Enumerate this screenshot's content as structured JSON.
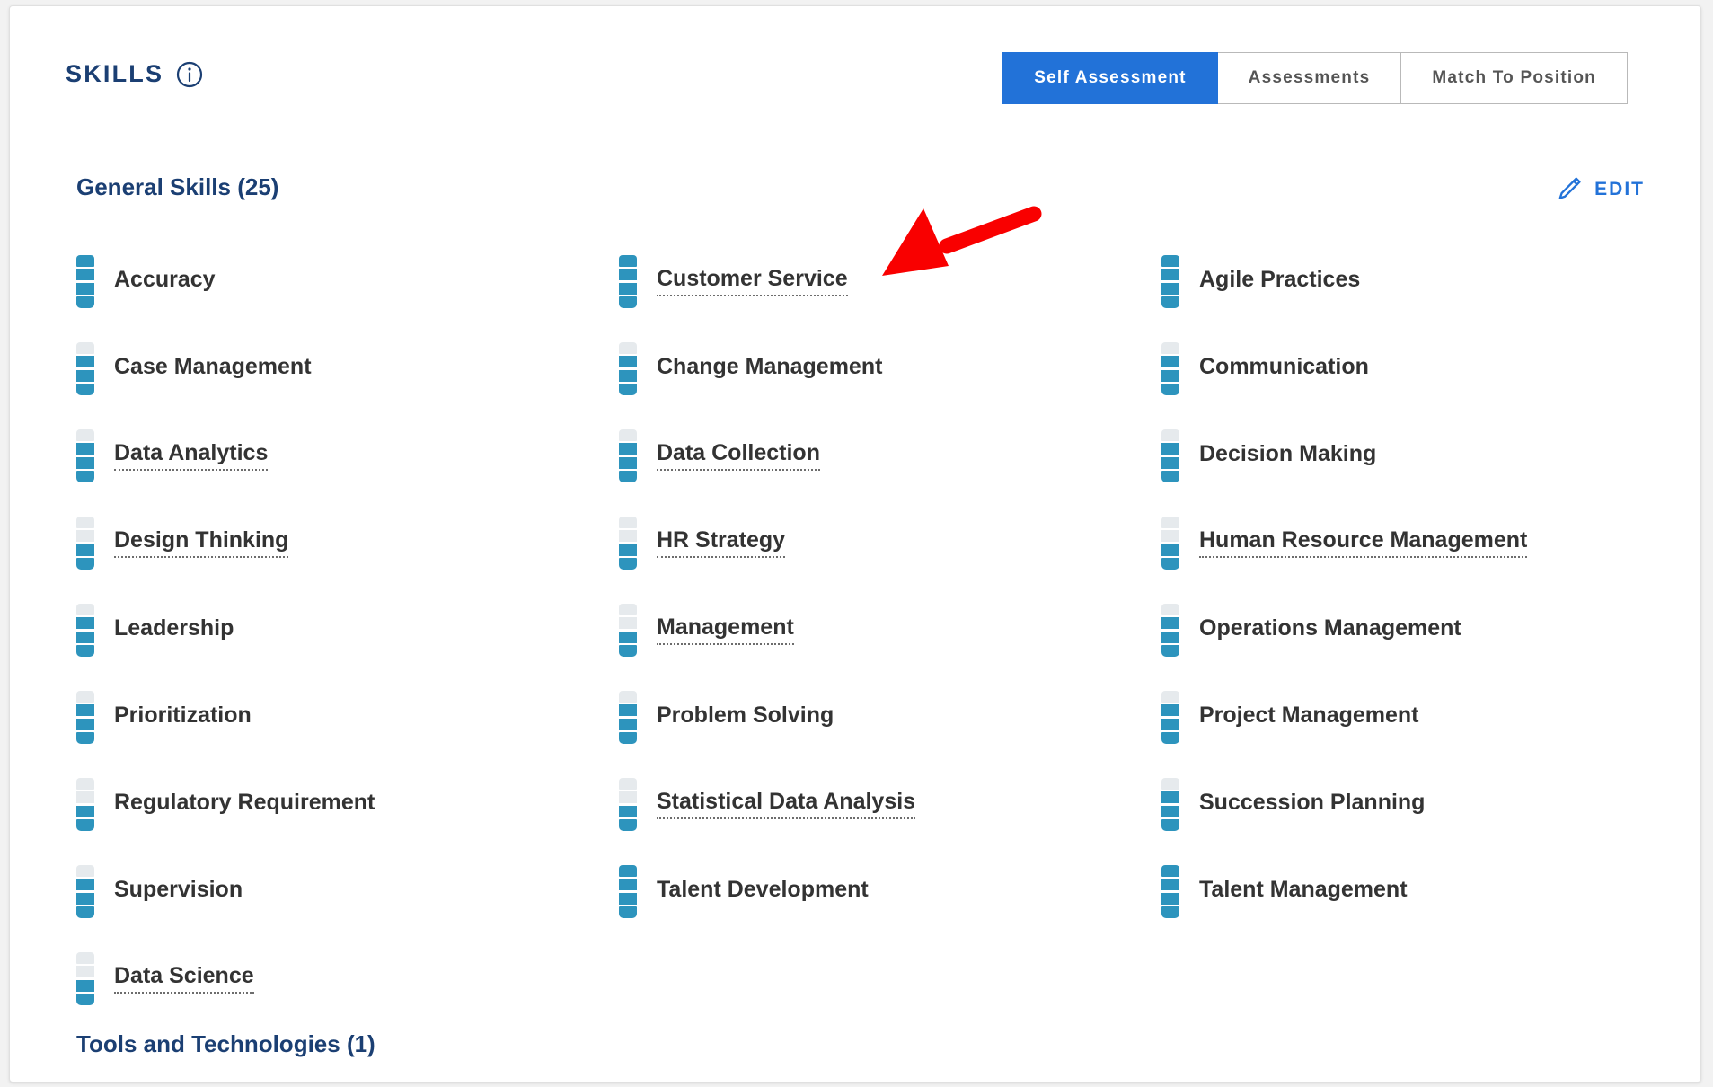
{
  "header": {
    "title": "SKILLS",
    "info_icon": "info-circle-icon",
    "tabs": [
      {
        "label": "Self Assessment",
        "active": true
      },
      {
        "label": "Assessments",
        "active": false
      },
      {
        "label": "Match To Position",
        "active": false
      }
    ]
  },
  "general_skills": {
    "heading": "General Skills (25)",
    "edit_label": "EDIT",
    "edit_icon": "pencil-icon",
    "max_level": 4,
    "columns": [
      [
        {
          "label": "Accuracy",
          "level": 4,
          "dotted": false
        },
        {
          "label": "Case Management",
          "level": 3,
          "dotted": false
        },
        {
          "label": "Data Analytics",
          "level": 3,
          "dotted": true
        },
        {
          "label": "Design Thinking",
          "level": 2,
          "dotted": true
        },
        {
          "label": "Leadership",
          "level": 3,
          "dotted": false
        },
        {
          "label": "Prioritization",
          "level": 3,
          "dotted": false
        },
        {
          "label": "Regulatory Requirement",
          "level": 2,
          "dotted": false
        },
        {
          "label": "Supervision",
          "level": 3,
          "dotted": false
        },
        {
          "label": "Data Science",
          "level": 2,
          "dotted": true
        }
      ],
      [
        {
          "label": "Customer Service",
          "level": 4,
          "dotted": true
        },
        {
          "label": "Change Management",
          "level": 3,
          "dotted": false
        },
        {
          "label": "Data Collection",
          "level": 3,
          "dotted": true
        },
        {
          "label": "HR Strategy",
          "level": 2,
          "dotted": true
        },
        {
          "label": "Management",
          "level": 2,
          "dotted": true
        },
        {
          "label": "Problem Solving",
          "level": 3,
          "dotted": false
        },
        {
          "label": "Statistical Data Analysis",
          "level": 2,
          "dotted": true
        },
        {
          "label": "Talent Development",
          "level": 4,
          "dotted": false
        }
      ],
      [
        {
          "label": "Agile Practices",
          "level": 4,
          "dotted": false
        },
        {
          "label": "Communication",
          "level": 3,
          "dotted": false
        },
        {
          "label": "Decision Making",
          "level": 3,
          "dotted": false
        },
        {
          "label": "Human Resource Management",
          "level": 2,
          "dotted": true
        },
        {
          "label": "Operations Management",
          "level": 3,
          "dotted": false
        },
        {
          "label": "Project Management",
          "level": 3,
          "dotted": false
        },
        {
          "label": "Succession Planning",
          "level": 3,
          "dotted": false
        },
        {
          "label": "Talent Management",
          "level": 4,
          "dotted": false
        }
      ]
    ]
  },
  "tools_and_technologies": {
    "heading": "Tools and Technologies (1)"
  },
  "annotation": {
    "arrow_icon": "red-arrow-pointer",
    "points_at": "Customer Service"
  },
  "colors": {
    "accent_blue": "#2272d8",
    "navy": "#1b3f73",
    "meter_filled": "#2d94bd",
    "meter_empty": "#e6eaed",
    "annotation_red": "#f90000"
  }
}
